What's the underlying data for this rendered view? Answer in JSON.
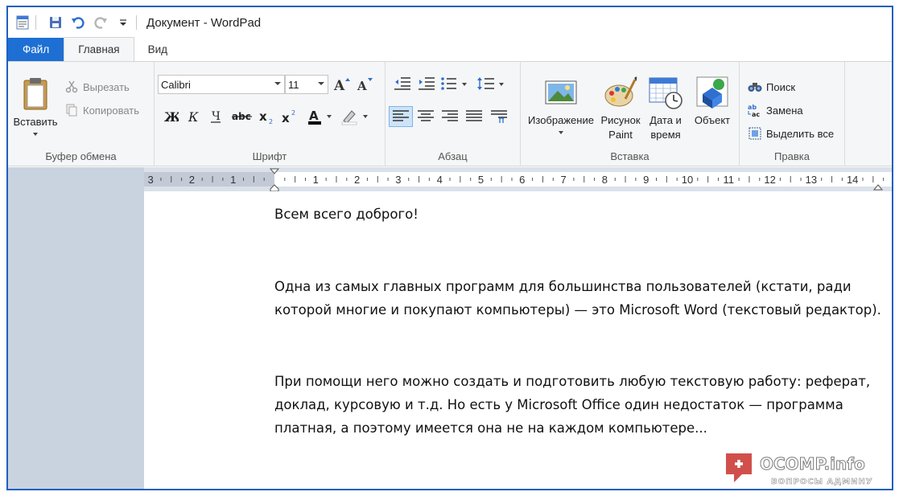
{
  "window": {
    "title": "Документ - WordPad"
  },
  "tabs": {
    "file": "Файл",
    "home": "Главная",
    "view": "Вид"
  },
  "clipboard": {
    "paste": "Вставить",
    "cut": "Вырезать",
    "copy": "Копировать",
    "label": "Буфер обмена"
  },
  "font": {
    "family": "Calibri",
    "size": "11",
    "label": "Шрифт"
  },
  "paragraph": {
    "label": "Абзац"
  },
  "insert": {
    "image": "Изображение",
    "paint_line1": "Рисунок",
    "paint_line2": "Paint",
    "datetime_line1": "Дата и",
    "datetime_line2": "время",
    "object": "Объект",
    "label": "Вставка"
  },
  "editing": {
    "find": "Поиск",
    "replace": "Замена",
    "select_all": "Выделить все",
    "label": "Правка"
  },
  "ruler": {
    "labels": [
      "3",
      "2",
      "1",
      "1",
      "2",
      "3",
      "4",
      "5",
      "6",
      "7",
      "8",
      "9",
      "10",
      "11",
      "12",
      "13",
      "14",
      "1"
    ]
  },
  "document": {
    "paragraphs": [
      "Всем всего доброго!",
      "Одна из самых главных программ для большинства пользователей (кстати, ради которой многие и покупают компьютеры) — это Microsoft Word (текстовый редактор).",
      "При помощи него можно создать и подготовить любую текстовую работу: реферат, доклад, курсовую и т.д. Но есть у Microsoft Office один недостаток — программа платная, а поэтому имеется она не на каждом компьютере..."
    ]
  },
  "watermark": {
    "brand": "OCOMP.info",
    "tagline": "ВОПРОСЫ АДМИНУ"
  },
  "colors": {
    "file_tab": "#1e6fd3",
    "frame": "#1f5fbf",
    "ribbon_bg": "#f5f6f7",
    "sidebar": "#c9d3e0"
  }
}
